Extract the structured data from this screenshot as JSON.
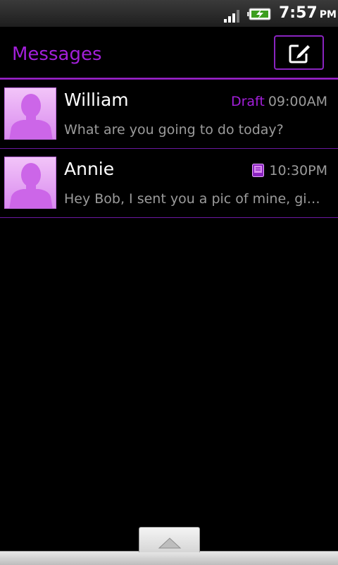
{
  "status_bar": {
    "time": "7:57",
    "ampm": "PM",
    "icons": [
      "signal-icon",
      "battery-charging-icon"
    ]
  },
  "header": {
    "title": "Messages",
    "compose_icon": "compose-icon"
  },
  "threads": [
    {
      "name": "William",
      "draft_label": "Draft",
      "time": "09:00AM",
      "snippet": "What are you going to do today?"
    },
    {
      "name": "Annie",
      "time": "10:30PM",
      "attachment_icon": "mms-icon",
      "snippet": "Hey Bob, I sent you a pic of mine, give me your comments"
    }
  ],
  "colors": {
    "accent": "#a21fd9",
    "text_primary": "#ffffff",
    "text_secondary": "#9b9b9b",
    "avatar_fill": "#d98aef"
  }
}
